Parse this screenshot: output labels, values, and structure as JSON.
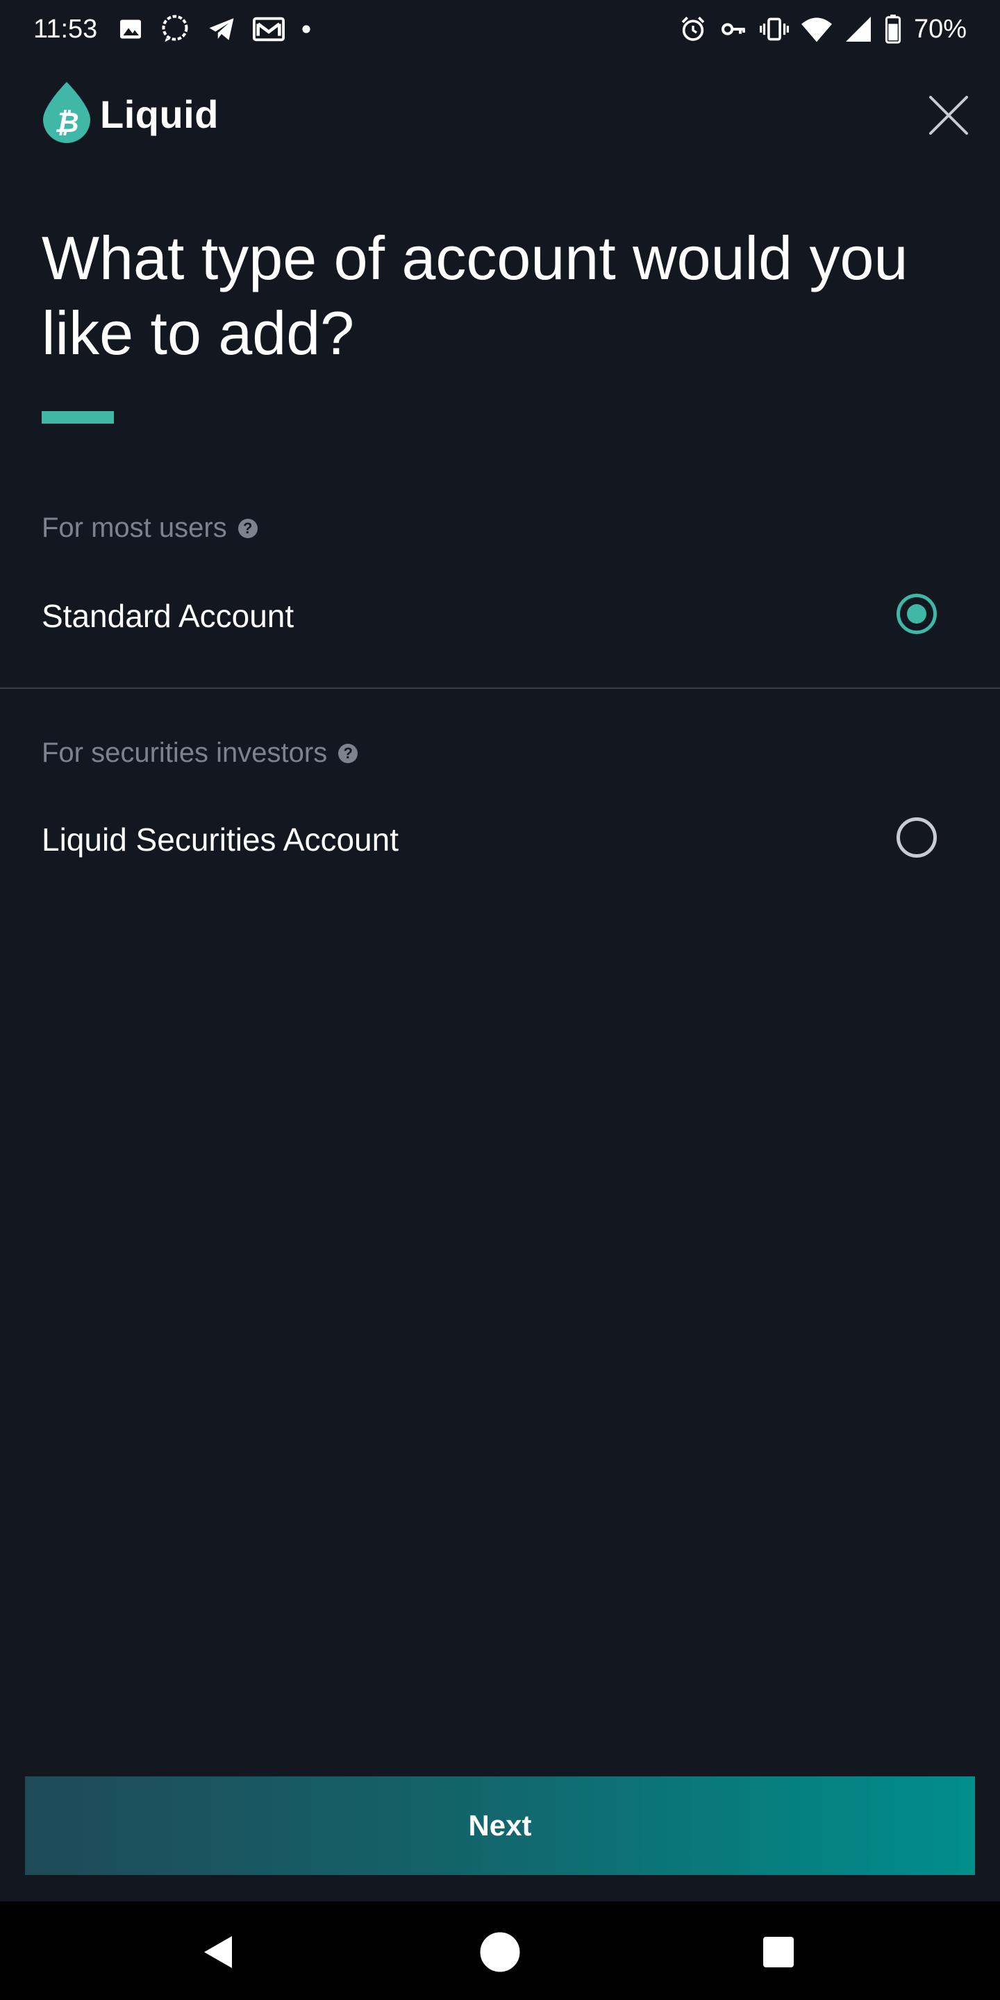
{
  "status_bar": {
    "time": "11:53",
    "battery": "70%",
    "left_icons": [
      "image-icon",
      "chat-bubble-icon",
      "telegram-icon",
      "mail-icon",
      "dot-icon"
    ],
    "right_icons": [
      "alarm-icon",
      "key-icon",
      "vibrate-icon",
      "wifi-icon",
      "signal-icon",
      "battery-icon"
    ]
  },
  "header": {
    "logo_text": "Liquid",
    "logo_icon": "bitcoin-drop-icon",
    "close_icon": "close-icon"
  },
  "main": {
    "title": "What type of account would you like to add?",
    "options": [
      {
        "section_label": "For most users",
        "label": "Standard Account",
        "selected": true
      },
      {
        "section_label": "For securities investors",
        "label": "Liquid Securities Account",
        "selected": false
      }
    ],
    "help_glyph": "?"
  },
  "footer": {
    "next_label": "Next"
  },
  "colors": {
    "background": "#13171f",
    "accent": "#3fb8a8",
    "muted_text": "#7d838c",
    "button_gradient_start": "#1f4a57",
    "button_gradient_end": "#008e8c"
  }
}
